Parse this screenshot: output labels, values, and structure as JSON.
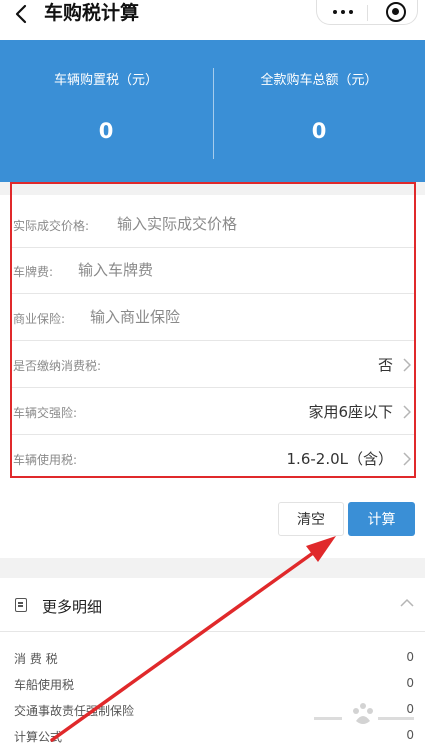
{
  "navbar": {
    "title": "车购税计算"
  },
  "banner": {
    "purchase_tax": {
      "label": "车辆购置税（元）",
      "value": "0"
    },
    "total_price": {
      "label": "全款购车总额（元）",
      "value": "0"
    }
  },
  "form": {
    "rows": [
      {
        "label": "实际成交价格:",
        "placeholder": "输入实际成交价格"
      },
      {
        "label": "车牌费:",
        "placeholder": "输入车牌费"
      },
      {
        "label": "商业保险:",
        "placeholder": "输入商业保险"
      },
      {
        "label": "是否缴纳消费税:",
        "value": "否"
      },
      {
        "label": "车辆交强险:",
        "value": "家用6座以下"
      },
      {
        "label": "车辆使用税:",
        "value": "1.6-2.0L（含）"
      }
    ]
  },
  "actions": {
    "clear_label": "清空",
    "calc_label": "计算"
  },
  "details": {
    "title": "更多明细",
    "rows": [
      {
        "label": "消 费 税",
        "value": "0"
      },
      {
        "label": "车船使用税",
        "value": "0"
      },
      {
        "label": "交通事故责任强制保险",
        "value": "0"
      },
      {
        "label": "计算公式",
        "value": "0"
      }
    ]
  },
  "colors": {
    "accent": "#3a8fd6",
    "annotation": "#e0292b"
  }
}
